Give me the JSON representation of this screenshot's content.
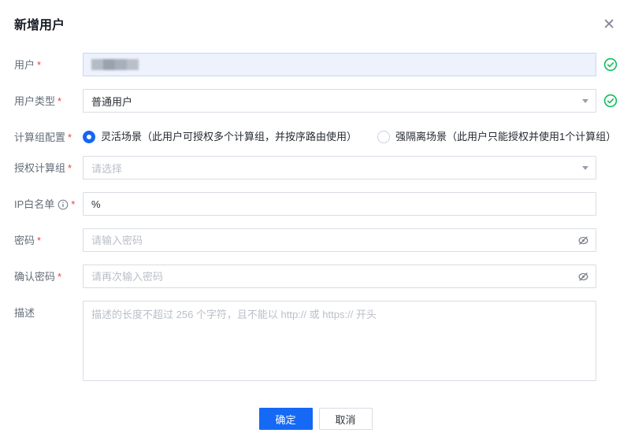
{
  "title": "新增用户",
  "required_marker": "*",
  "close_glyph": "✕",
  "fields": {
    "user": {
      "label": "用户",
      "value_state": "redacted"
    },
    "user_type": {
      "label": "用户类型",
      "value": "普通用户"
    },
    "compute_config": {
      "label": "计算组配置",
      "options": [
        {
          "label": "灵活场景（此用户可授权多个计算组，并按序路由使用）",
          "selected": true
        },
        {
          "label": "强隔离场景（此用户只能授权并使用1个计算组）",
          "selected": false
        }
      ]
    },
    "auth_compute_group": {
      "label": "授权计算组",
      "placeholder": "请选择"
    },
    "ip_whitelist": {
      "label": "IP白名单",
      "value": "%"
    },
    "password": {
      "label": "密码",
      "placeholder": "请输入密码"
    },
    "confirm_password": {
      "label": "确认密码",
      "placeholder": "请再次输入密码"
    },
    "description": {
      "label": "描述",
      "placeholder": "描述的长度不超过 256 个字符，且不能以 http:// 或 https:// 开头"
    }
  },
  "buttons": {
    "confirm": "确定",
    "cancel": "取消"
  },
  "icons": {
    "valid": "check-circle",
    "hide_password": "eye-slash",
    "info": "info-circle",
    "dropdown": "caret-down"
  },
  "colors": {
    "accent_blue": "#1569f5",
    "success_green": "#0abf5b",
    "danger_red": "#e64545",
    "filled_field_bg": "#edf2fc"
  }
}
